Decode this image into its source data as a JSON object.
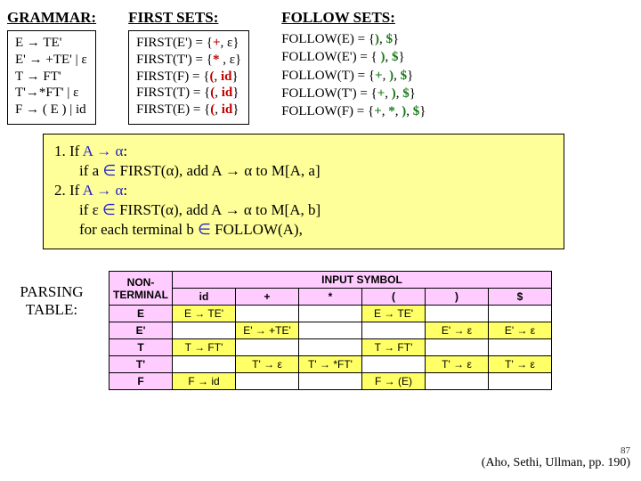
{
  "headings": {
    "grammar": "GRAMMAR:",
    "first": "FIRST SETS:",
    "follow": "FOLLOW SETS:",
    "ptable": "PARSING TABLE:"
  },
  "grammar": {
    "r1": "E  → TE'",
    "r2": "E' → +TE' | ε",
    "r3": "T  → FT'",
    "r4": "T'→*FT' | ε",
    "r5": "F → ( E ) | id"
  },
  "first": {
    "l1a": "FIRST(E') = {",
    "l1b": "+",
    "l1c": ", ε}",
    "l2a": "FIRST(T') = {",
    "l2b": "*",
    "l2c": " , ε}",
    "l3a": "FIRST(F) = {",
    "l3b": "(",
    "l3c": ", ",
    "l3d": "id",
    "l3e": "}",
    "l4a": "FIRST(T) = {",
    "l4b": "(",
    "l4c": ", ",
    "l4d": "id",
    "l4e": "}",
    "l5a": "FIRST(E)  = {",
    "l5b": "(",
    "l5c": ", ",
    "l5d": "id",
    "l5e": "}"
  },
  "follow": {
    "l1a": "FOLLOW(E) = {",
    "l1b": ")",
    "l1c": ", ",
    "l1d": "$",
    "l1e": "}",
    "l2a": "FOLLOW(E') = { ",
    "l2b": ")",
    "l2c": ", ",
    "l2d": "$",
    "l2e": "}",
    "l3a": "FOLLOW(T) = {",
    "l3b": "+",
    "l3c": ",  ",
    "l3d": ")",
    "l3e": ", ",
    "l3f": "$",
    "l3g": "}",
    "l4a": "FOLLOW(T') = {",
    "l4b": "+",
    "l4c": ", ",
    "l4d": ")",
    "l4e": ", ",
    "l4f": "$",
    "l4g": "}",
    "l5a": "FOLLOW(F) = {",
    "l5b": "+",
    "l5c": ", ",
    "l5d": "*",
    "l5e": ", ",
    "l5f": ")",
    "l5g": ", ",
    "l5h": "$",
    "l5i": "}"
  },
  "rules": {
    "r1a": "1. If ",
    "r1b": "A → α",
    "r1c": ":",
    "r2a": "if a ",
    "r2b": "∈",
    "r2c": " FIRST(α), add A → α to M[A, a]",
    "r3a": "2. If ",
    "r3b": "A → α",
    "r3c": ":",
    "r4a": "if ε ",
    "r4b": "∈",
    "r4c": " FIRST(α), add A → α to M[A, b]",
    "r5a": "for each terminal b ",
    "r5b": "∈",
    "r5c": " FOLLOW(A),"
  },
  "ptable": {
    "hdr_nt": "NON-\nTERMINAL",
    "hdr_in": "INPUT SYMBOL",
    "cols": {
      "c1": "id",
      "c2": "+",
      "c3": "*",
      "c4": "(",
      "c5": ")",
      "c6": "$"
    },
    "rows": {
      "r1": "E",
      "r2": "E'",
      "r3": "T",
      "r4": "T'",
      "r5": "F"
    },
    "cells": {
      "E_id": "E → TE'",
      "E_lp": "E → TE'",
      "Ep_plus": "E' → +TE'",
      "Ep_rp": "E' → ε",
      "Ep_dol": "E' → ε",
      "T_id": "T → FT'",
      "T_lp": "T → FT'",
      "Tp_plus": "T' → ε",
      "Tp_star": "T' → *FT'",
      "Tp_rp": "T' → ε",
      "Tp_dol": "T' → ε",
      "F_id": "F → id",
      "F_lp": "F → (E)"
    }
  },
  "footer": {
    "slide": "87",
    "cite": "(Aho, Sethi, Ullman, pp. 190)"
  }
}
